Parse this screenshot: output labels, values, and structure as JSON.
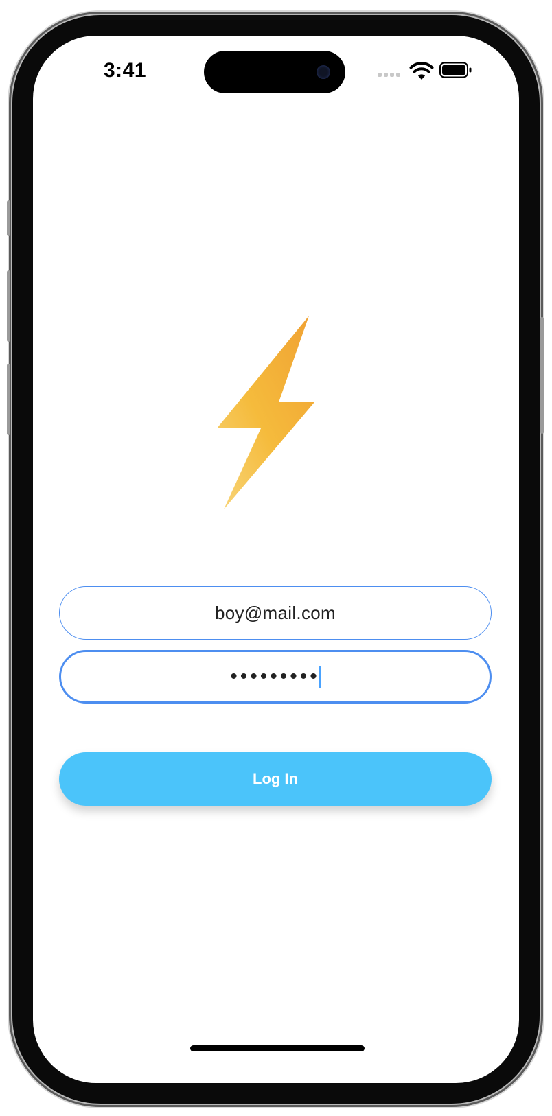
{
  "status_bar": {
    "time": "3:41",
    "icons": [
      "cellular-signal-icon",
      "wifi-icon",
      "battery-icon"
    ]
  },
  "app": {
    "logo_icon": "lightning-bolt-icon",
    "email": {
      "value": "boy@mail.com"
    },
    "password": {
      "value": "•••••••••",
      "focused": true
    },
    "login_button": {
      "label": "Log In"
    }
  },
  "colors": {
    "accent": "#4d8ef0",
    "button": "#4bc4fa",
    "bolt_top": "#f0a133",
    "bolt_bottom": "#f8d57a"
  }
}
